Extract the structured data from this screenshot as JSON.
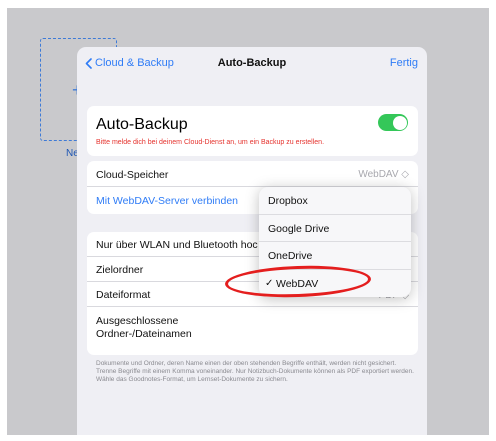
{
  "background": {
    "tile_plus": "+",
    "tile_label": "Neu"
  },
  "nav": {
    "back_label": "Cloud & Backup",
    "title": "Auto-Backup",
    "done_label": "Fertig"
  },
  "auto_backup": {
    "label": "Auto-Backup",
    "enabled": true,
    "warning": "Bitte melde dich bei deinem Cloud-Dienst an, um ein Backup zu erstellen."
  },
  "cloud": {
    "label": "Cloud-Speicher",
    "value": "WebDAV ◇",
    "connect_label": "Mit WebDAV-Server verbinden"
  },
  "settings": {
    "wlan_label": "Nur über WLAN und Bluetooth hoc",
    "folder_label": "Zielordner",
    "format_label": "Dateiformat",
    "format_value": "PDF ◇",
    "excluded_label_line1": "Ausgeschlossene",
    "excluded_label_line2": "Ordner-/Dateinamen"
  },
  "footer_text": "Dokumente und Ordner, deren Name einen der oben stehenden Begriffe enthält, werden nicht gesichert. Trenne Begriffe mit einem Komma voneinander. Nur Notizbuch-Dokumente können als PDF exportiert werden. Wähle das Goodnotes-Format, um Lernset-Dokumente zu sichern.",
  "dropdown": {
    "items": [
      "Dropbox",
      "Google Drive",
      "OneDrive",
      "WebDAV"
    ],
    "selected": "WebDAV",
    "check_glyph": "✓"
  },
  "colors": {
    "accent": "#2f7cf6",
    "toggle_on": "#34c759",
    "warning": "#e5322d",
    "annotation": "#e41e1e"
  }
}
